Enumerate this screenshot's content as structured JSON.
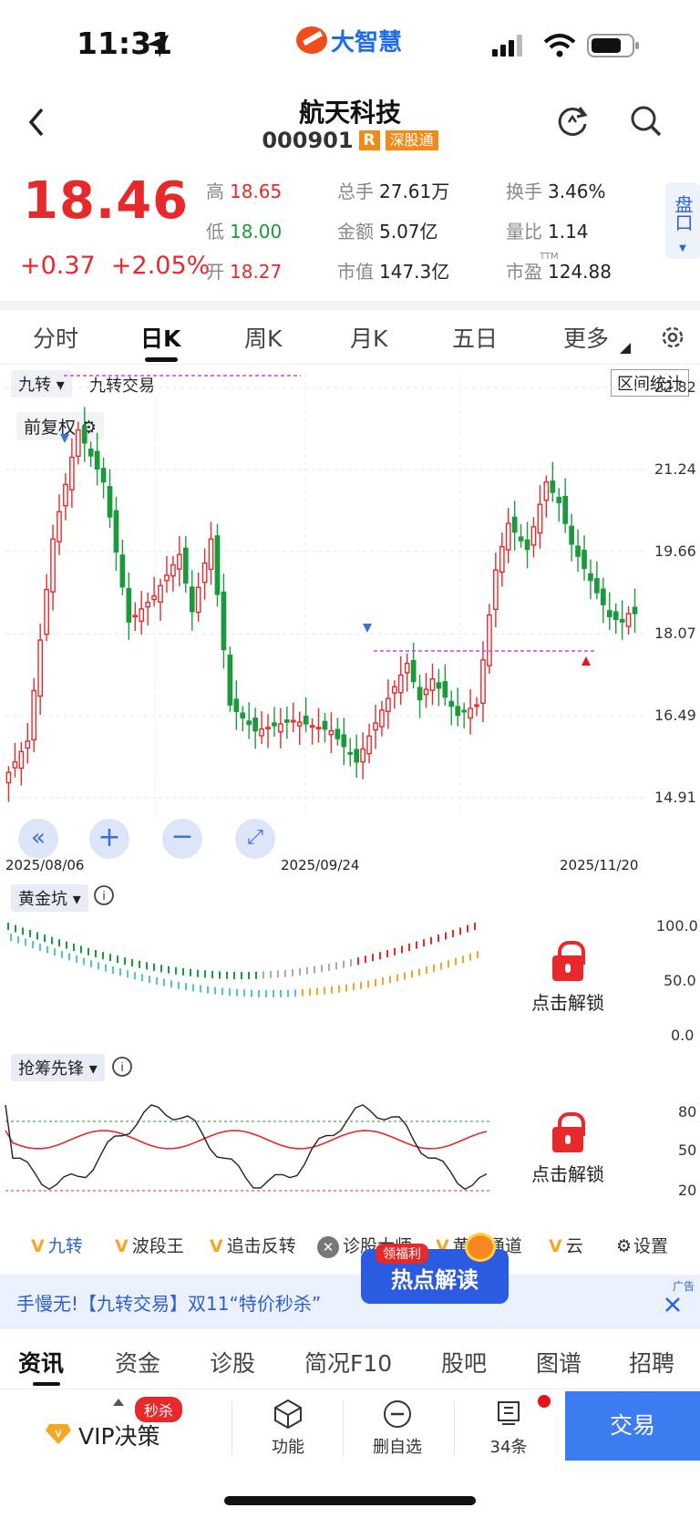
{
  "status_bar": {
    "time": "11:31",
    "brand": "大智慧"
  },
  "header": {
    "title": "航天科技",
    "code": "000901",
    "tag_r": "R",
    "tag_market": "深股通"
  },
  "quote": {
    "price": "18.46",
    "change": "+0.37",
    "change_pct": "+2.05%",
    "items": [
      {
        "label": "高",
        "value": "18.65",
        "color": "red"
      },
      {
        "label": "总手",
        "value": "27.61万",
        "color": "dark"
      },
      {
        "label": "换手",
        "value": "3.46%",
        "color": "dark"
      },
      {
        "label": "低",
        "value": "18.00",
        "color": "green"
      },
      {
        "label": "金额",
        "value": "5.07亿",
        "color": "dark"
      },
      {
        "label": "量比",
        "value": "1.14",
        "color": "dark"
      },
      {
        "label": "开",
        "value": "18.27",
        "color": "red"
      },
      {
        "label": "市值",
        "value": "147.3亿",
        "color": "dark"
      },
      {
        "label": "市盈",
        "value": "124.88",
        "color": "dark"
      }
    ],
    "pe_superscript": "TTM",
    "side_button": "盘口"
  },
  "tabs": [
    "分时",
    "日K",
    "周K",
    "月K",
    "五日",
    "更多"
  ],
  "active_tab": "日K",
  "chart_controls": {
    "indicator": "九转",
    "indicator_name": "九转交易",
    "range_button": "区间统计",
    "adjust": "前复权"
  },
  "chart_data": {
    "type": "candlestick",
    "y_ticks": [
      "22.82",
      "21.24",
      "19.66",
      "18.07",
      "16.49",
      "14.91"
    ],
    "x_ticks": [
      "2025/08/06",
      "2025/09/24",
      "2025/11/20"
    ],
    "ylim": [
      14.91,
      22.82
    ]
  },
  "indicator1": {
    "name": "黄金坑",
    "y_ticks": [
      "100.0",
      "50.0",
      "0.0"
    ],
    "lock_text": "点击解锁"
  },
  "indicator2": {
    "name": "抢筹先锋",
    "y_ticks": [
      "80",
      "50",
      "20"
    ],
    "lock_text": "点击解锁"
  },
  "toolbar": [
    "九转",
    "波段王",
    "追击反转",
    "诊股大师",
    "黄金通道",
    "云",
    "设置"
  ],
  "ad": {
    "text": "手慢无!【九转交易】双11“特价秒杀”",
    "badge": "广告",
    "promo_top": "领福利",
    "promo_main": "热点解读"
  },
  "news_tabs": [
    "资讯",
    "资金",
    "诊股",
    "简况F10",
    "股吧",
    "图谱",
    "招聘"
  ],
  "active_news_tab": "资讯",
  "bottom_bar": {
    "vip": "VIP决策",
    "vip_badge": "秒杀",
    "func": "功能",
    "remove": "删自选",
    "count": "34条",
    "trade": "交易"
  }
}
